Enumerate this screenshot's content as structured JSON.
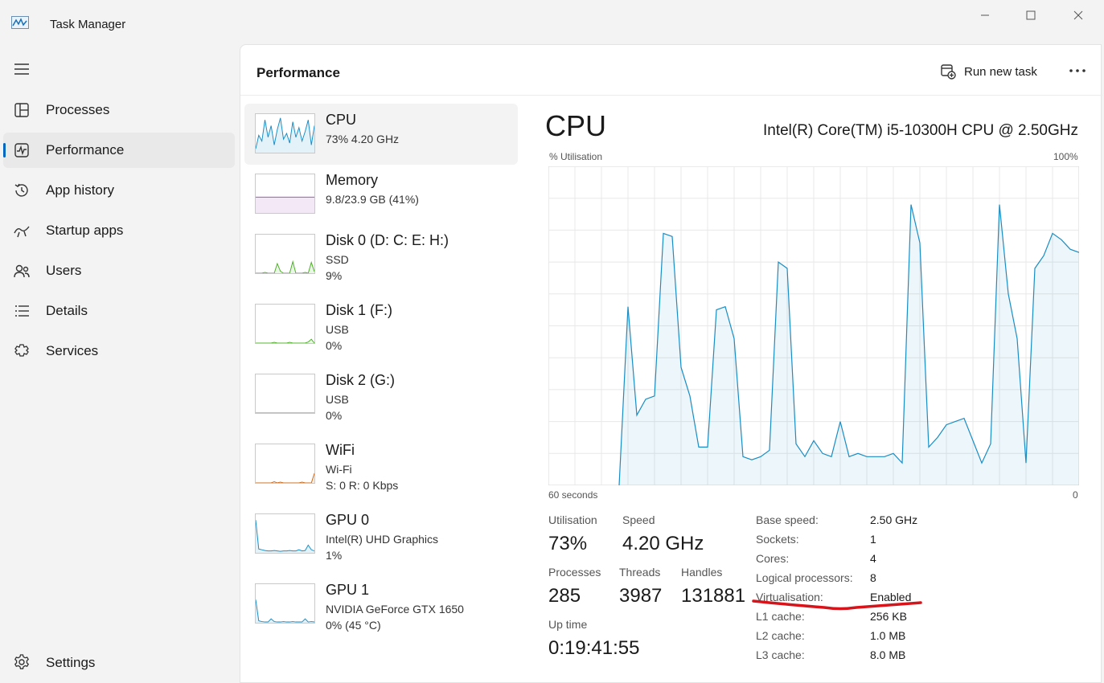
{
  "window": {
    "title": "Task Manager"
  },
  "nav": {
    "items": [
      {
        "label": "Processes",
        "icon": "processes-icon"
      },
      {
        "label": "Performance",
        "icon": "performance-icon",
        "active": true
      },
      {
        "label": "App history",
        "icon": "app-history-icon"
      },
      {
        "label": "Startup apps",
        "icon": "startup-apps-icon"
      },
      {
        "label": "Users",
        "icon": "users-icon"
      },
      {
        "label": "Details",
        "icon": "details-icon"
      },
      {
        "label": "Services",
        "icon": "services-icon"
      }
    ],
    "settings_label": "Settings"
  },
  "header": {
    "title": "Performance",
    "run_new_task": "Run new task"
  },
  "devices": [
    {
      "name": "CPU",
      "line1": "73%  4.20 GHz",
      "line2": "",
      "color": "#1a8dc5",
      "active": true
    },
    {
      "name": "Memory",
      "line1": "9.8/23.9 GB (41%)",
      "line2": "",
      "color": "#9c3fb8"
    },
    {
      "name": "Disk 0 (D: C: E: H:)",
      "line1": "SSD",
      "line2": "9%",
      "color": "#4caf26"
    },
    {
      "name": "Disk 1 (F:)",
      "line1": "USB",
      "line2": "0%",
      "color": "#4caf26"
    },
    {
      "name": "Disk 2 (G:)",
      "line1": "USB",
      "line2": "0%",
      "color": "#4caf26"
    },
    {
      "name": "WiFi",
      "line1": "Wi-Fi",
      "line2": "S: 0  R: 0 Kbps",
      "color": "#c8691a"
    },
    {
      "name": "GPU 0",
      "line1": "Intel(R) UHD Graphics",
      "line2": "1%",
      "color": "#1a8dc5"
    },
    {
      "name": "GPU 1",
      "line1": "NVIDIA GeForce GTX 1650",
      "line2": "0%  (45 °C)",
      "color": "#1a8dc5"
    }
  ],
  "cpu": {
    "title": "CPU",
    "model": "Intel(R) Core(TM) i5-10300H CPU @ 2.50GHz",
    "graph_label": "% Utilisation",
    "graph_max": "100%",
    "graph_time": "60 seconds",
    "graph_min": "0",
    "stats": {
      "utilisation_label": "Utilisation",
      "utilisation": "73%",
      "speed_label": "Speed",
      "speed": "4.20 GHz",
      "processes_label": "Processes",
      "processes": "285",
      "threads_label": "Threads",
      "threads": "3987",
      "handles_label": "Handles",
      "handles": "131881",
      "uptime_label": "Up time",
      "uptime": "0:19:41:55"
    },
    "specs": [
      {
        "key": "Base speed:",
        "value": "2.50 GHz"
      },
      {
        "key": "Sockets:",
        "value": "1"
      },
      {
        "key": "Cores:",
        "value": "4"
      },
      {
        "key": "Logical processors:",
        "value": "8"
      },
      {
        "key": "Virtualisation:",
        "value": "Enabled"
      },
      {
        "key": "L1 cache:",
        "value": "256 KB"
      },
      {
        "key": "L2 cache:",
        "value": "1.0 MB"
      },
      {
        "key": "L3 cache:",
        "value": "8.0 MB"
      }
    ]
  },
  "chart_data": {
    "type": "area",
    "title": "",
    "xlabel": "60 seconds",
    "ylabel": "% Utilisation",
    "xlim": [
      0,
      60
    ],
    "ylim": [
      0,
      100
    ],
    "grid": true,
    "series": [
      {
        "color": "#1a8dc5",
        "x": [
          8,
          9,
          10,
          11,
          12,
          13,
          14,
          15,
          16,
          17,
          18,
          19,
          20,
          21,
          22,
          23,
          24,
          25,
          26,
          27,
          28,
          29,
          30,
          31,
          32,
          33,
          34,
          35,
          36,
          37,
          38,
          39,
          40,
          41,
          42,
          43,
          44,
          45,
          46,
          47,
          48,
          49,
          50,
          51,
          52,
          53,
          54,
          55,
          56,
          57,
          58,
          59,
          60
        ],
        "y": [
          0,
          56,
          22,
          27,
          28,
          79,
          78,
          37,
          28,
          12,
          12,
          55,
          56,
          46,
          9,
          8,
          9,
          11,
          70,
          68,
          13,
          9,
          14,
          10,
          9,
          20,
          9,
          10,
          9,
          9,
          9,
          10,
          7,
          88,
          76,
          12,
          15,
          19,
          20,
          21,
          14,
          7,
          13,
          88,
          60,
          46,
          7,
          68,
          72,
          79,
          77,
          74,
          73
        ]
      }
    ]
  },
  "thumbs": {
    "cpu": [
      10,
      45,
      30,
      85,
      40,
      70,
      20,
      60,
      90,
      35,
      50,
      25,
      80,
      40,
      65,
      30,
      55,
      85,
      20,
      70
    ],
    "memory": [
      41,
      41,
      41,
      41,
      41,
      41,
      41,
      41,
      41,
      41,
      41,
      41,
      41,
      41,
      41,
      41,
      41,
      41,
      41,
      41
    ],
    "disk0": [
      0,
      0,
      0,
      2,
      0,
      0,
      0,
      25,
      5,
      0,
      0,
      0,
      30,
      0,
      0,
      0,
      2,
      0,
      28,
      4
    ],
    "disk1": [
      0,
      0,
      0,
      0,
      0,
      0,
      2,
      0,
      0,
      0,
      0,
      2,
      0,
      0,
      0,
      0,
      0,
      3,
      10,
      0
    ],
    "disk2": [
      0,
      0,
      0,
      0,
      0,
      0,
      0,
      0,
      0,
      0,
      0,
      0,
      0,
      0,
      0,
      0,
      0,
      0,
      0,
      0
    ],
    "wifi": [
      0,
      0,
      0,
      0,
      0,
      0,
      3,
      0,
      2,
      0,
      0,
      0,
      0,
      0,
      0,
      2,
      0,
      0,
      0,
      25
    ],
    "gpu0": [
      85,
      10,
      8,
      6,
      5,
      5,
      6,
      5,
      4,
      5,
      5,
      6,
      5,
      5,
      8,
      5,
      6,
      20,
      8,
      5
    ],
    "gpu1": [
      60,
      5,
      3,
      2,
      2,
      10,
      3,
      2,
      2,
      3,
      2,
      2,
      3,
      2,
      2,
      2,
      10,
      2,
      3,
      2
    ]
  }
}
